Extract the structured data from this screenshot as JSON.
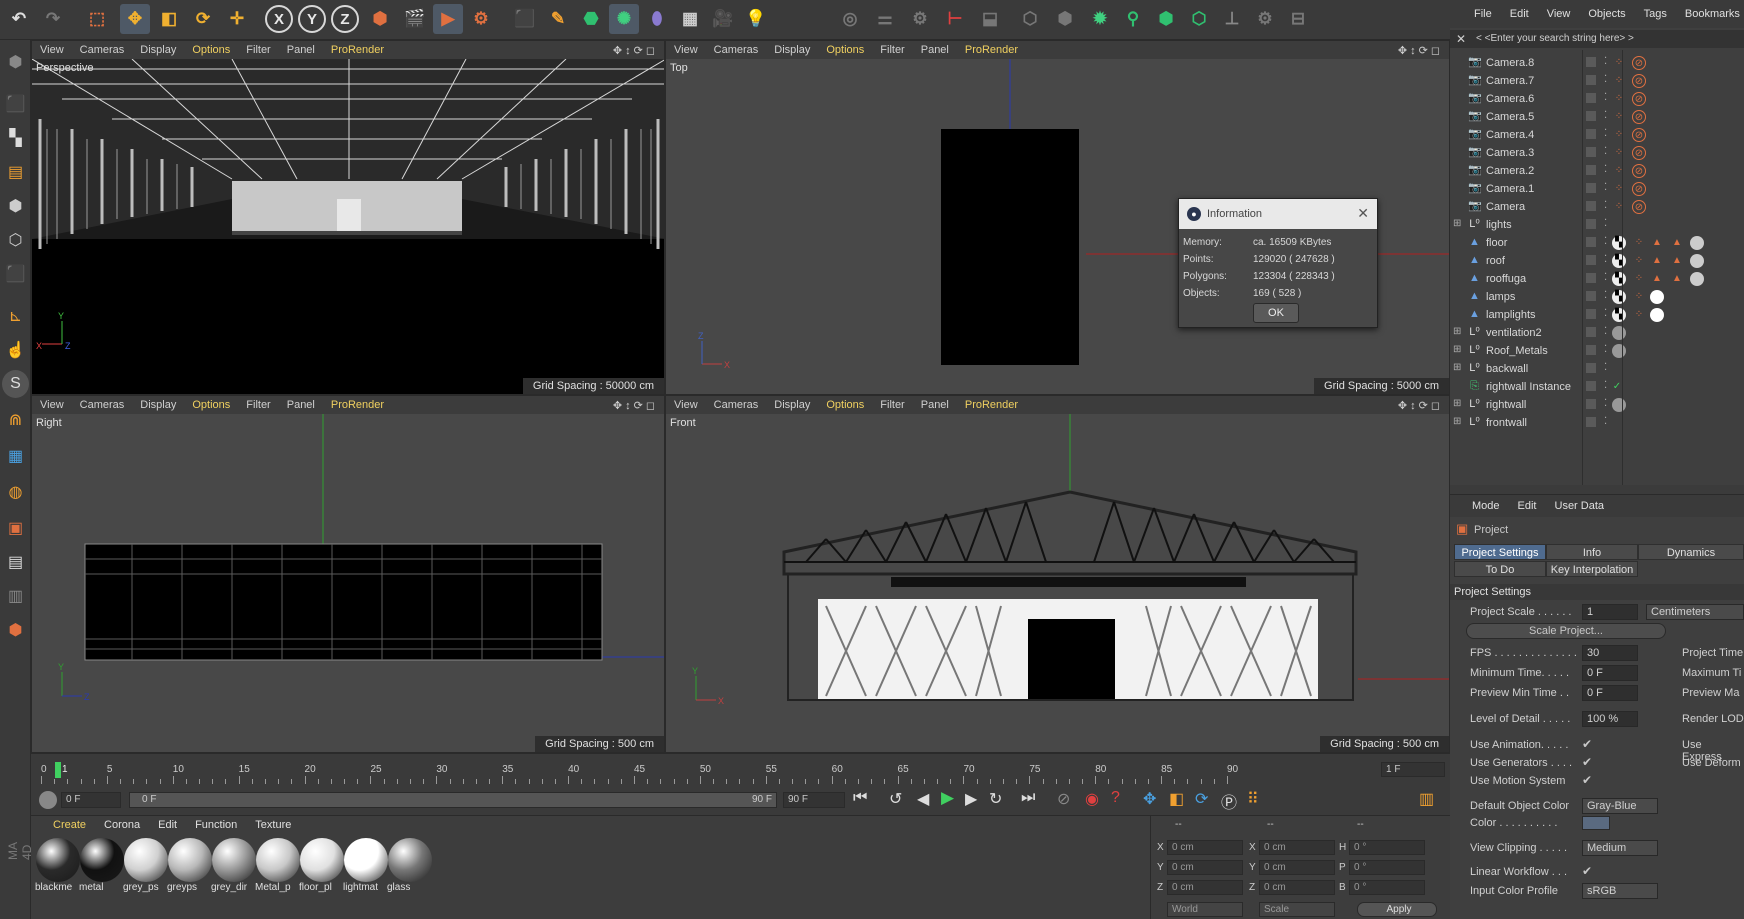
{
  "toolbar": {
    "axis_x": "X",
    "axis_y": "Y",
    "axis_z": "Z"
  },
  "viewports": {
    "menu": [
      "View",
      "Cameras",
      "Display",
      "Options",
      "Filter",
      "Panel",
      "ProRender"
    ],
    "perspective": {
      "label": "Perspective",
      "grid": "Grid Spacing : 50000 cm"
    },
    "top": {
      "label": "Top",
      "grid": "Grid Spacing : 5000 cm"
    },
    "right": {
      "label": "Right",
      "grid": "Grid Spacing : 500 cm"
    },
    "front": {
      "label": "Front",
      "grid": "Grid Spacing : 500 cm"
    }
  },
  "dialog": {
    "title": "Information",
    "rows": [
      {
        "label": "Memory:",
        "value": "ca. 16509 KBytes"
      },
      {
        "label": "Points:",
        "value": "129020 ( 247628 )"
      },
      {
        "label": "Polygons:",
        "value": "123304 ( 228343 )"
      },
      {
        "label": "Objects:",
        "value": "169 ( 528 )"
      }
    ],
    "ok": "OK"
  },
  "object_manager": {
    "menu": [
      "File",
      "Edit",
      "View",
      "Objects",
      "Tags",
      "Bookmarks"
    ],
    "search_placeholder": "< <Enter your search string here> >",
    "objects": [
      {
        "name": "Camera.8",
        "type": "camera"
      },
      {
        "name": "Camera.7",
        "type": "camera"
      },
      {
        "name": "Camera.6",
        "type": "camera"
      },
      {
        "name": "Camera.5",
        "type": "camera"
      },
      {
        "name": "Camera.4",
        "type": "camera"
      },
      {
        "name": "Camera.3",
        "type": "camera"
      },
      {
        "name": "Camera.2",
        "type": "camera"
      },
      {
        "name": "Camera.1",
        "type": "camera"
      },
      {
        "name": "Camera",
        "type": "camera"
      },
      {
        "name": "lights",
        "type": "null"
      },
      {
        "name": "floor",
        "type": "poly"
      },
      {
        "name": "roof",
        "type": "poly"
      },
      {
        "name": "rooffuga",
        "type": "poly"
      },
      {
        "name": "lamps",
        "type": "poly"
      },
      {
        "name": "lamplights",
        "type": "poly"
      },
      {
        "name": "ventilation2",
        "type": "null"
      },
      {
        "name": "Roof_Metals",
        "type": "null"
      },
      {
        "name": "backwall",
        "type": "null"
      },
      {
        "name": "rightwall Instance",
        "type": "instance"
      },
      {
        "name": "rightwall",
        "type": "null"
      },
      {
        "name": "frontwall",
        "type": "null"
      }
    ]
  },
  "attribute_manager": {
    "menu": [
      "Mode",
      "Edit",
      "User Data"
    ],
    "object": "Project",
    "tabs": [
      "Project Settings",
      "Info",
      "Dynamics",
      "To Do",
      "Key Interpolation"
    ],
    "section": "Project Settings",
    "project_scale_label": "Project Scale . . . . . .",
    "project_scale": "1",
    "unit": "Centimeters",
    "scale_button": "Scale Project...",
    "fps_label": "FPS . . . . . . . . . . . . . .",
    "fps": "30",
    "project_time_label": "Project Time",
    "min_time_label": "Minimum Time. . . . .",
    "min_time": "0 F",
    "max_time_label": "Maximum Ti",
    "preview_min_label": "Preview Min Time . .",
    "preview_min": "0 F",
    "preview_max_label": "Preview Ma",
    "lod_label": "Level of Detail . . . . .",
    "lod": "100 %",
    "render_lod_label": "Render LOD",
    "use_animation": "Use Animation. . . . .",
    "use_generators": "Use Generators . . . .",
    "use_motion": "Use Motion System",
    "use_express": "Use Express",
    "use_deform": "Use Deform",
    "default_color_label": "Default Object Color",
    "default_color": "Gray-Blue",
    "color_label": "Color . . . . . . . . . .",
    "view_clipping_label": "View Clipping . . . . .",
    "view_clipping": "Medium",
    "linear_workflow": "Linear Workflow . . .",
    "input_color_label": "Input Color Profile",
    "input_color": "sRGB"
  },
  "timeline": {
    "ticks": [
      "0",
      "5",
      "10",
      "15",
      "20",
      "25",
      "30",
      "35",
      "40",
      "45",
      "50",
      "55",
      "60",
      "65",
      "70",
      "75",
      "80",
      "85",
      "90"
    ],
    "current": "1",
    "current_frame_field": "1 F",
    "start_field": "0 F",
    "range_start": "0 F",
    "range_end": "90 F",
    "end_field": "90 F"
  },
  "materials": {
    "menu": [
      "Create",
      "Corona",
      "Edit",
      "Function",
      "Texture"
    ],
    "items": [
      {
        "name": "blackme",
        "color": "#2a2a2a"
      },
      {
        "name": "metal",
        "color": "#111111"
      },
      {
        "name": "grey_ps",
        "color": "#d0d0d0"
      },
      {
        "name": "greyps",
        "color": "#b8b8b8"
      },
      {
        "name": "grey_dir",
        "color": "#9a9a9a"
      },
      {
        "name": "Metal_p",
        "color": "#c8c8c8"
      },
      {
        "name": "floor_pl",
        "color": "#e0e0e0"
      },
      {
        "name": "lightmat",
        "color": "#ffffff"
      },
      {
        "name": "glass",
        "color": "#777777"
      }
    ]
  },
  "coordinates": {
    "header": [
      "--",
      "--",
      "--"
    ],
    "labels_pos": [
      "X",
      "Y",
      "Z"
    ],
    "labels_size": [
      "X",
      "Y",
      "Z"
    ],
    "labels_rot": [
      "H",
      "P",
      "B"
    ],
    "pos_values": [
      "0 cm",
      "0 cm",
      "0 cm"
    ],
    "size_values": [
      "0 cm",
      "0 cm",
      "0 cm"
    ],
    "rot_values": [
      "0 °",
      "0 °",
      "0 °"
    ],
    "mode1": "World",
    "mode2": "Scale",
    "apply": "Apply"
  },
  "brand": "MA 4D"
}
